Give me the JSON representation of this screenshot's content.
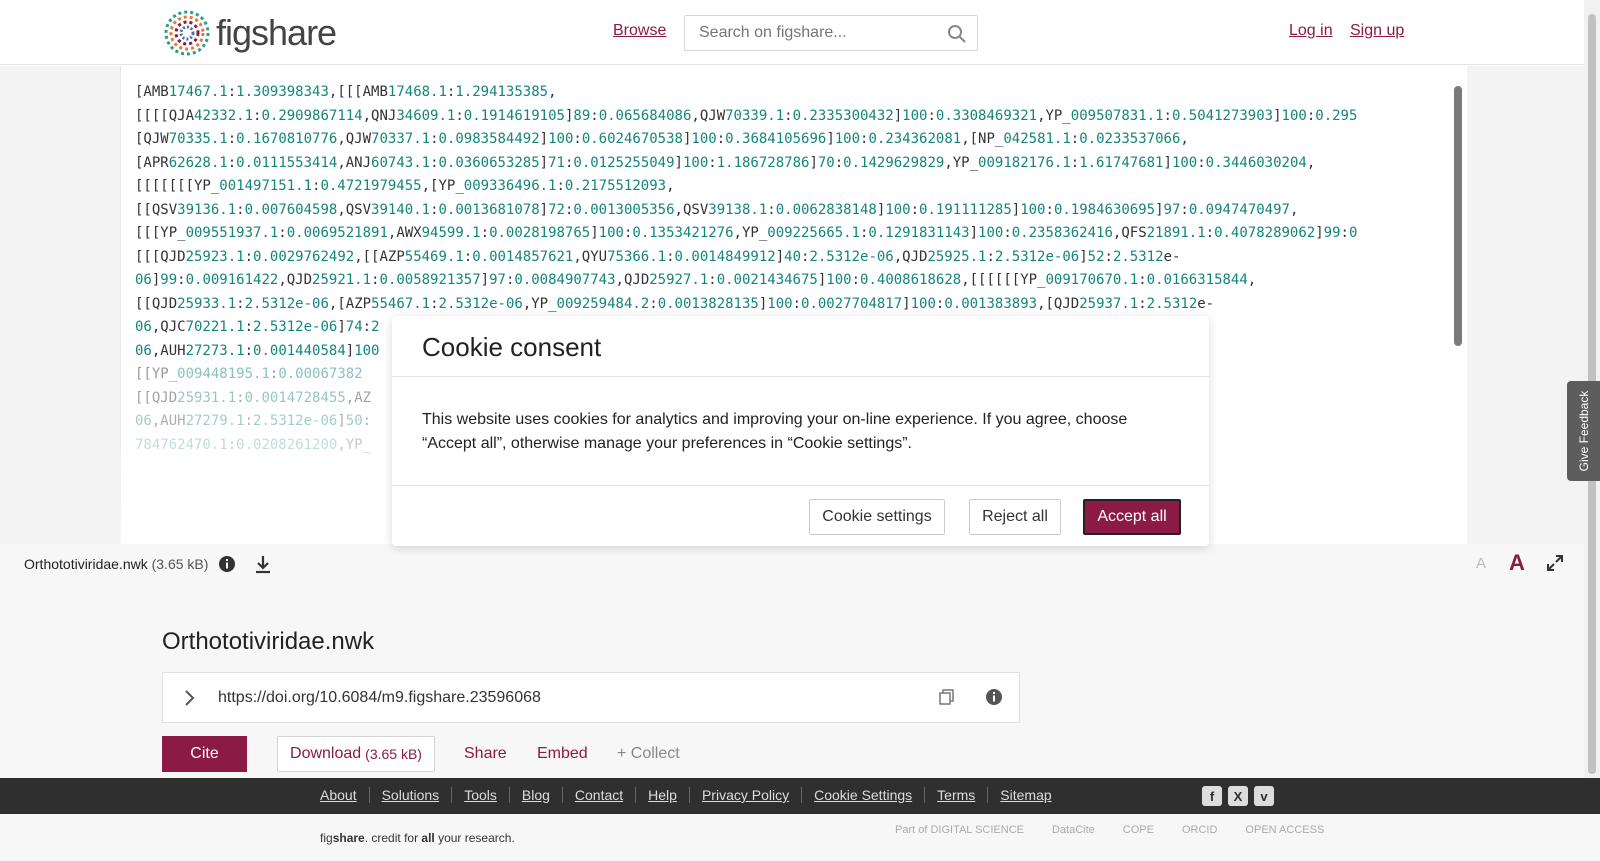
{
  "header": {
    "logo_text": "figshare",
    "browse_label": "Browse",
    "search_placeholder": "Search on figshare...",
    "login_label": "Log in",
    "signup_label": "Sign up"
  },
  "viewer": {
    "code_lines": [
      "[AMB17467.1:1.309398343,[[[AMB17468.1:1.294135385,",
      "[[[[QJA42332.1:0.2909867114,QNJ34609.1:0.1914619105]89:0.065684086,QJW70339.1:0.2335300432]100:0.3308469321,YP_009507831.1:0.5041273903]100:0.295",
      "[QJW70335.1:0.1670810776,QJW70337.1:0.0983584492]100:0.6024670538]100:0.3684105696]100:0.234362081,[NP_042581.1:0.0233537066,",
      "[APR62628.1:0.0111553414,ANJ60743.1:0.0360653285]71:0.0125255049]100:1.186728786]70:0.1429629829,YP_009182176.1:1.61747681]100:0.3446030204,",
      "[[[[[[[YP_001497151.1:0.4721979455,[YP_009336496.1:0.2175512093,",
      "[[QSV39136.1:0.007604598,QSV39140.1:0.0013681078]72:0.0013005356,QSV39138.1:0.0062838148]100:0.191111285]100:0.1984630695]97:0.0947470497,",
      "[[[YP_009551937.1:0.0069521891,AWX94599.1:0.0028198765]100:0.1353421276,YP_009225665.1:0.1291831143]100:0.2358362416,QFS21891.1:0.4078289062]99:0",
      "[[[QJD25923.1:0.0029762492,[[AZP55469.1:0.0014857621,QYU75366.1:0.0014849912]40:2.5312e-06,QJD25925.1:2.5312e-06]52:2.5312e-",
      "06]99:0.009161422,QJD25921.1:0.0058921357]97:0.0084907743,QJD25927.1:0.0021434675]100:0.4008618628,[[[[[[YP_009170670.1:0.0166315844,",
      "[[QJD25933.1:2.5312e-06,[AZP55467.1:2.5312e-06,YP_009259484.2:0.0013828135]100:0.0027704817]100:0.001383893,[QJD25937.1:2.5312e-",
      "06,QJC70221.1:2.5312e-06]74:2",
      "06,AUH27273.1:0.001440584]100",
      "[[YP_009448195.1:0.00067382",
      "[[QJD25931.1:0.0014728455,AZ",
      "06,AUH27279.1:2.5312e-06]50:",
      "784762470.1:0.0208261200,YP_"
    ],
    "feedback_label": "Give Feedback"
  },
  "filebar": {
    "file_name": "Orthototiviridae.nwk",
    "file_size": "(3.65 kB)",
    "font_small": "A",
    "font_large": "A"
  },
  "item": {
    "title": "Orthototiviridae.nwk",
    "doi": "https://doi.org/10.6084/m9.figshare.23596068",
    "cite_label": "Cite",
    "download_label": "Download",
    "download_size": "(3.65 kB)",
    "share_label": "Share",
    "embed_label": "Embed",
    "collect_label": "+ Collect"
  },
  "footer": {
    "links": [
      "About",
      "Solutions",
      "Tools",
      "Blog",
      "Contact",
      "Help",
      "Privacy Policy",
      "Cookie Settings",
      "Terms",
      "Sitemap"
    ],
    "tagline_prefix": "fig",
    "tagline_brand": "share",
    "tagline_middle": ". credit for ",
    "tagline_all": "all",
    "tagline_suffix": " your research.",
    "partners": [
      "Part of DIGITAL SCIENCE",
      "DataCite",
      "COPE",
      "ORCID",
      "OPEN ACCESS"
    ]
  },
  "cookie_modal": {
    "title": "Cookie consent",
    "text": "This website uses cookies for analytics and improving your on-line experience. If you agree, choose “Accept all”, otherwise manage your preferences in “Cookie settings”.",
    "settings_label": "Cookie settings",
    "reject_label": "Reject all",
    "accept_label": "Accept all"
  },
  "colors": {
    "brand": "#8b1a45",
    "number": "#15857a",
    "footer_bg": "#2f2f2f"
  }
}
